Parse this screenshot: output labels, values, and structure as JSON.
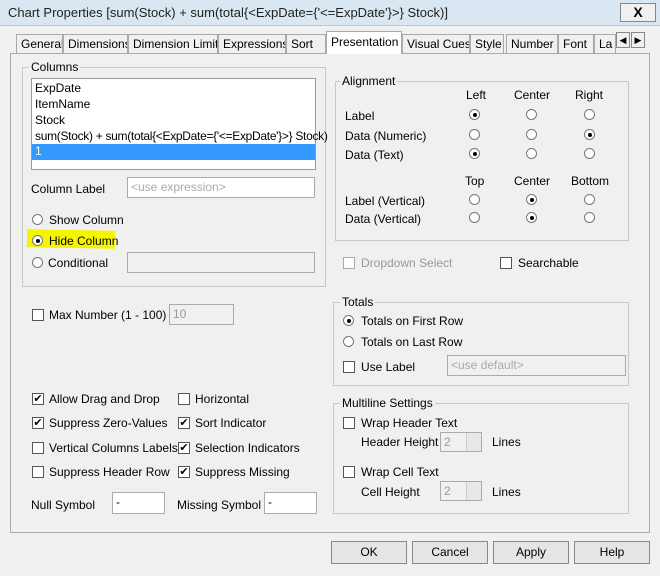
{
  "window": {
    "title": "Chart Properties [sum(Stock) + sum(total{<ExpDate={'<=ExpDate'}>} Stock)]",
    "close": "X"
  },
  "tabs": [
    "General",
    "Dimensions",
    "Dimension Limits",
    "Expressions",
    "Sort",
    "Presentation",
    "Visual Cues",
    "Style",
    "Number",
    "Font",
    "La"
  ],
  "tab_scroll": {
    "left": "◀",
    "right": "▶"
  },
  "columns": {
    "legend": "Columns",
    "items": [
      "ExpDate",
      "ItemName",
      "Stock",
      "sum(Stock) + sum(total{<ExpDate={'<=ExpDate'}>} Stock)",
      "1"
    ],
    "selected_index": 4,
    "column_label": "Column Label",
    "column_label_placeholder": "<use expression>",
    "show": "Show Column",
    "hide": "Hide Column",
    "conditional": "Conditional",
    "selected_visibility": "Hide Column"
  },
  "alignment": {
    "legend": "Alignment",
    "cols": [
      "Left",
      "Center",
      "Right"
    ],
    "rows": [
      "Label",
      "Data (Numeric)",
      "Data (Text)"
    ],
    "vcols": [
      "Top",
      "Center",
      "Bottom"
    ],
    "vrows": [
      "Label (Vertical)",
      "Data (Vertical)"
    ],
    "dropdown_select": "Dropdown Select",
    "searchable": "Searchable"
  },
  "max_number": {
    "label": "Max Number (1 - 100)",
    "value": "10"
  },
  "totals": {
    "legend": "Totals",
    "first": "Totals on First Row",
    "last": "Totals on Last Row",
    "use_label": "Use Label",
    "label_placeholder": "<use default>"
  },
  "options": {
    "allow_drag": "Allow Drag and Drop",
    "suppress_zero": "Suppress Zero-Values",
    "vertical_labels": "Vertical Columns Labels",
    "suppress_header": "Suppress Header Row",
    "horizontal": "Horizontal",
    "sort_indicator": "Sort Indicator",
    "selection_indicators": "Selection Indicators",
    "suppress_missing": "Suppress Missing",
    "null_symbol": "Null Symbol",
    "null_value": "-",
    "missing_symbol": "Missing Symbol",
    "missing_value": "-"
  },
  "multiline": {
    "legend": "Multiline Settings",
    "wrap_header": "Wrap Header Text",
    "header_height": "Header Height",
    "header_value": "2",
    "lines": "Lines",
    "wrap_cell": "Wrap Cell Text",
    "cell_height": "Cell Height",
    "cell_value": "2"
  },
  "buttons": {
    "ok": "OK",
    "cancel": "Cancel",
    "apply": "Apply",
    "help": "Help"
  },
  "check_mark": "✔"
}
